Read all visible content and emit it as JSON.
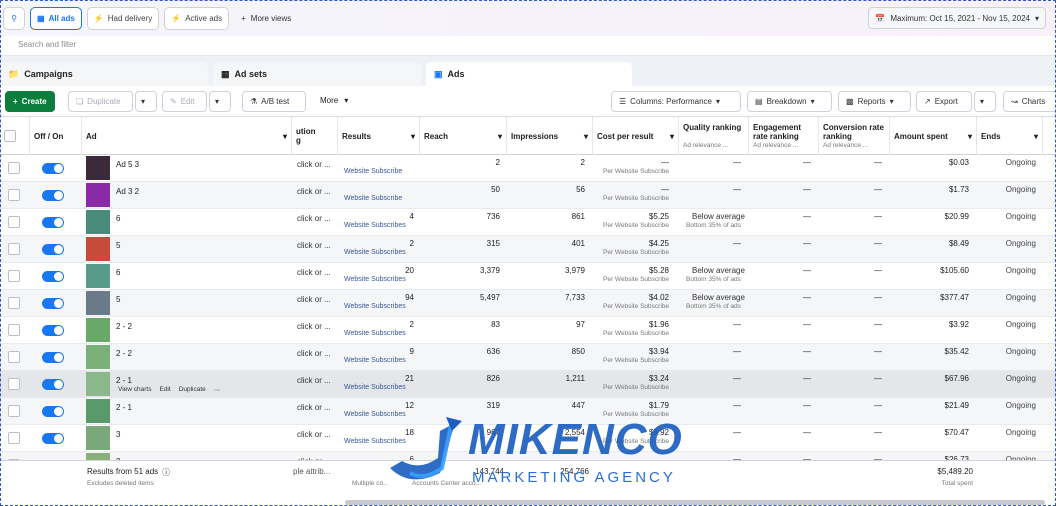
{
  "topbar": {
    "filters": [
      "All ads",
      "Had delivery",
      "Active ads"
    ],
    "more_views": "More views",
    "date_range": "Maximum: Oct 15, 2021 - Nov 15, 2024"
  },
  "search": {
    "placeholder": "Search and filter"
  },
  "tabs": [
    "Campaigns",
    "Ad sets",
    "Ads"
  ],
  "toolbar": {
    "create": "Create",
    "duplicate": "Duplicate",
    "edit": "Edit",
    "abtest": "A/B test",
    "more": "More",
    "columns": "Columns: Performance",
    "breakdown": "Breakdown",
    "reports": "Reports",
    "export": "Export",
    "charts": "Charts"
  },
  "columns": {
    "onoff": "Off / On",
    "ad": "Ad",
    "attribution": "ution\ng",
    "results": "Results",
    "reach": "Reach",
    "impressions": "Impressions",
    "cpr": "Cost per result",
    "quality": "Quality ranking",
    "quality_sub": "Ad relevance ...",
    "engagement": "Engagement rate ranking",
    "engagement_sub": "Ad relevance ...",
    "conversion": "Conversion rate ranking",
    "conversion_sub": "Ad relevance ...",
    "spent": "Amount spent",
    "ends": "Ends"
  },
  "rows": [
    {
      "name": "Ad 5 3",
      "attr": "click or ...",
      "results": "",
      "result_type": "Website Subscribe",
      "reach": "2",
      "impressions": "2",
      "cpr": "—",
      "cpr_type": "Per Website Subscribe",
      "quality": "—",
      "quality_sub": "",
      "engagement": "—",
      "conversion": "—",
      "spent": "$0.03",
      "ends": "Ongoing",
      "thumb": "#3a2a3a"
    },
    {
      "name": "Ad 3 2",
      "attr": "click or ...",
      "results": "",
      "result_type": "Website Subscribe",
      "reach": "50",
      "impressions": "56",
      "cpr": "—",
      "cpr_type": "Per Website Subscribe",
      "quality": "—",
      "quality_sub": "",
      "engagement": "—",
      "conversion": "—",
      "spent": "$1.73",
      "ends": "Ongoing",
      "thumb": "#8a2aa8"
    },
    {
      "name": "6",
      "attr": "click or ...",
      "results": "4",
      "result_type": "Website Subscribes",
      "reach": "736",
      "impressions": "861",
      "cpr": "$5.25",
      "cpr_type": "Per Website Subscribe",
      "quality": "Below average",
      "quality_sub": "Bottom 35% of ads",
      "engagement": "—",
      "conversion": "—",
      "spent": "$20.99",
      "ends": "Ongoing",
      "thumb": "#4a8a7a"
    },
    {
      "name": "5",
      "attr": "click or ...",
      "results": "2",
      "result_type": "Website Subscribes",
      "reach": "315",
      "impressions": "401",
      "cpr": "$4.25",
      "cpr_type": "Per Website Subscribe",
      "quality": "—",
      "quality_sub": "",
      "engagement": "—",
      "conversion": "—",
      "spent": "$8.49",
      "ends": "Ongoing",
      "thumb": "#c84a3a"
    },
    {
      "name": "6",
      "attr": "click or ...",
      "results": "20",
      "result_type": "Website Subscribes",
      "reach": "3,379",
      "impressions": "3,979",
      "cpr": "$5.28",
      "cpr_type": "Per Website Subscribe",
      "quality": "Below average",
      "quality_sub": "Bottom 35% of ads",
      "engagement": "—",
      "conversion": "—",
      "spent": "$105.60",
      "ends": "Ongoing",
      "thumb": "#5a9a8a"
    },
    {
      "name": "5",
      "attr": "click or ...",
      "results": "94",
      "result_type": "Website Subscribes",
      "reach": "5,497",
      "impressions": "7,733",
      "cpr": "$4.02",
      "cpr_type": "Per Website Subscribe",
      "quality": "Below average",
      "quality_sub": "Bottom 35% of ads",
      "engagement": "—",
      "conversion": "—",
      "spent": "$377.47",
      "ends": "Ongoing",
      "thumb": "#6a7a8a"
    },
    {
      "name": "2 - 2",
      "attr": "click or ...",
      "results": "2",
      "result_type": "Website Subscribes",
      "reach": "83",
      "impressions": "97",
      "cpr": "$1.96",
      "cpr_type": "Per Website Subscribe",
      "quality": "—",
      "quality_sub": "",
      "engagement": "—",
      "conversion": "—",
      "spent": "$3.92",
      "ends": "Ongoing",
      "thumb": "#6aa86a"
    },
    {
      "name": "2 - 2",
      "attr": "click or ...",
      "results": "9",
      "result_type": "Website Subscribes",
      "reach": "636",
      "impressions": "850",
      "cpr": "$3.94",
      "cpr_type": "Per Website Subscribe",
      "quality": "—",
      "quality_sub": "",
      "engagement": "—",
      "conversion": "—",
      "spent": "$35.42",
      "ends": "Ongoing",
      "thumb": "#7ab07a"
    },
    {
      "name": "2 - 1",
      "attr": "click or ...",
      "results": "21",
      "result_type": "Website Subscribes",
      "reach": "826",
      "impressions": "1,211",
      "cpr": "$3.24",
      "cpr_type": "Per Website Subscribe",
      "quality": "—",
      "quality_sub": "",
      "engagement": "—",
      "conversion": "—",
      "spent": "$67.96",
      "ends": "Ongoing",
      "thumb": "#8ab88a",
      "actions": [
        "View charts",
        "Edit",
        "Duplicate"
      ]
    },
    {
      "name": "2 - 1",
      "attr": "click or ...",
      "results": "12",
      "result_type": "Website Subscribes",
      "reach": "319",
      "impressions": "447",
      "cpr": "$1.79",
      "cpr_type": "Per Website Subscribe",
      "quality": "—",
      "quality_sub": "",
      "engagement": "—",
      "conversion": "—",
      "spent": "$21.49",
      "ends": "Ongoing",
      "thumb": "#5a9a6a"
    },
    {
      "name": "3",
      "attr": "click or ...",
      "results": "18",
      "result_type": "Website Subscribes",
      "reach": "967",
      "impressions": "2,554",
      "cpr": "$3.92",
      "cpr_type": "Per Website Subscribe",
      "quality": "—",
      "quality_sub": "",
      "engagement": "—",
      "conversion": "—",
      "spent": "$70.47",
      "ends": "Ongoing",
      "thumb": "#7aa87a"
    },
    {
      "name": "2",
      "attr": "click or ...",
      "results": "6",
      "result_type": "Website Subscribes",
      "reach": "",
      "impressions": "",
      "cpr": "",
      "cpr_type": "",
      "quality": "—",
      "quality_sub": "",
      "engagement": "—",
      "conversion": "—",
      "spent": "$26.73",
      "ends": "Ongoing",
      "thumb": "#8ab07a"
    }
  ],
  "footer": {
    "results": "Results from 51 ads",
    "excluded": "Excludes deleted items",
    "attr": "ple attrib...",
    "results_sub": "Multiple co...",
    "reach": "143,744",
    "reach_sub": "Accounts Center acco...",
    "impressions": "254,766",
    "spent": "$5,489.20",
    "spent_sub": "Total spent"
  },
  "watermark": {
    "brand": "MIKENCO",
    "tagline": "MARKETING AGENCY"
  }
}
